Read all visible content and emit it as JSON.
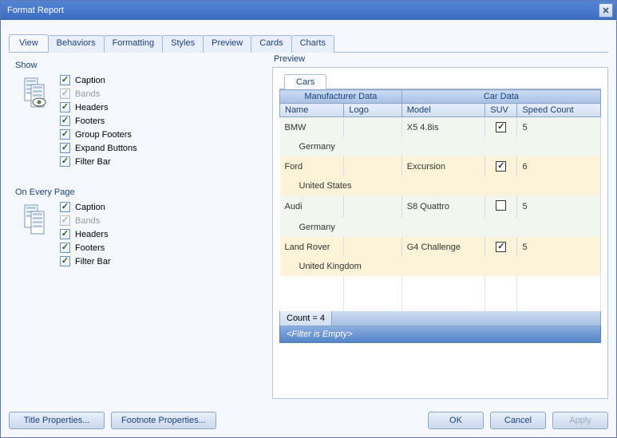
{
  "window": {
    "title": "Format Report"
  },
  "tabs": [
    "View",
    "Behaviors",
    "Formatting",
    "Styles",
    "Preview",
    "Cards",
    "Charts"
  ],
  "active_tab": 0,
  "show": {
    "label": "Show",
    "items": [
      {
        "label": "Caption",
        "checked": true,
        "disabled": false
      },
      {
        "label": "Bands",
        "checked": true,
        "disabled": true
      },
      {
        "label": "Headers",
        "checked": true,
        "disabled": false
      },
      {
        "label": "Footers",
        "checked": true,
        "disabled": false
      },
      {
        "label": "Group Footers",
        "checked": true,
        "disabled": false
      },
      {
        "label": "Expand Buttons",
        "checked": true,
        "disabled": false
      },
      {
        "label": "Filter Bar",
        "checked": true,
        "disabled": false
      }
    ]
  },
  "every_page": {
    "label": "On Every Page",
    "items": [
      {
        "label": "Caption",
        "checked": true,
        "disabled": false
      },
      {
        "label": "Bands",
        "checked": true,
        "disabled": true
      },
      {
        "label": "Headers",
        "checked": true,
        "disabled": false
      },
      {
        "label": "Footers",
        "checked": true,
        "disabled": false
      },
      {
        "label": "Filter Bar",
        "checked": true,
        "disabled": false
      }
    ]
  },
  "preview": {
    "label": "Preview",
    "inner_tab": "Cars",
    "band1": "Manufacturer Data",
    "band2": "Car Data",
    "cols": {
      "name": "Name",
      "logo": "Logo",
      "model": "Model",
      "suv": "SUV",
      "speed": "Speed Count"
    },
    "rows": [
      {
        "name": "BMW",
        "logo": "",
        "model": "X5 4.8is",
        "suv": true,
        "speed": "5",
        "country": "Germany"
      },
      {
        "name": "Ford",
        "logo": "",
        "model": "Excursion",
        "suv": true,
        "speed": "6",
        "country": "United States"
      },
      {
        "name": "Audi",
        "logo": "",
        "model": "S8 Quattro",
        "suv": false,
        "speed": "5",
        "country": "Germany"
      },
      {
        "name": "Land Rover",
        "logo": "",
        "model": "G4 Challenge",
        "suv": true,
        "speed": "5",
        "country": "United Kingdom"
      }
    ],
    "count": "Count = 4",
    "filter": "<Filter is Empty>"
  },
  "footer": {
    "title_props": "Title Properties...",
    "footnote_props": "Footnote Properties...",
    "ok": "OK",
    "cancel": "Cancel",
    "apply": "Apply"
  }
}
